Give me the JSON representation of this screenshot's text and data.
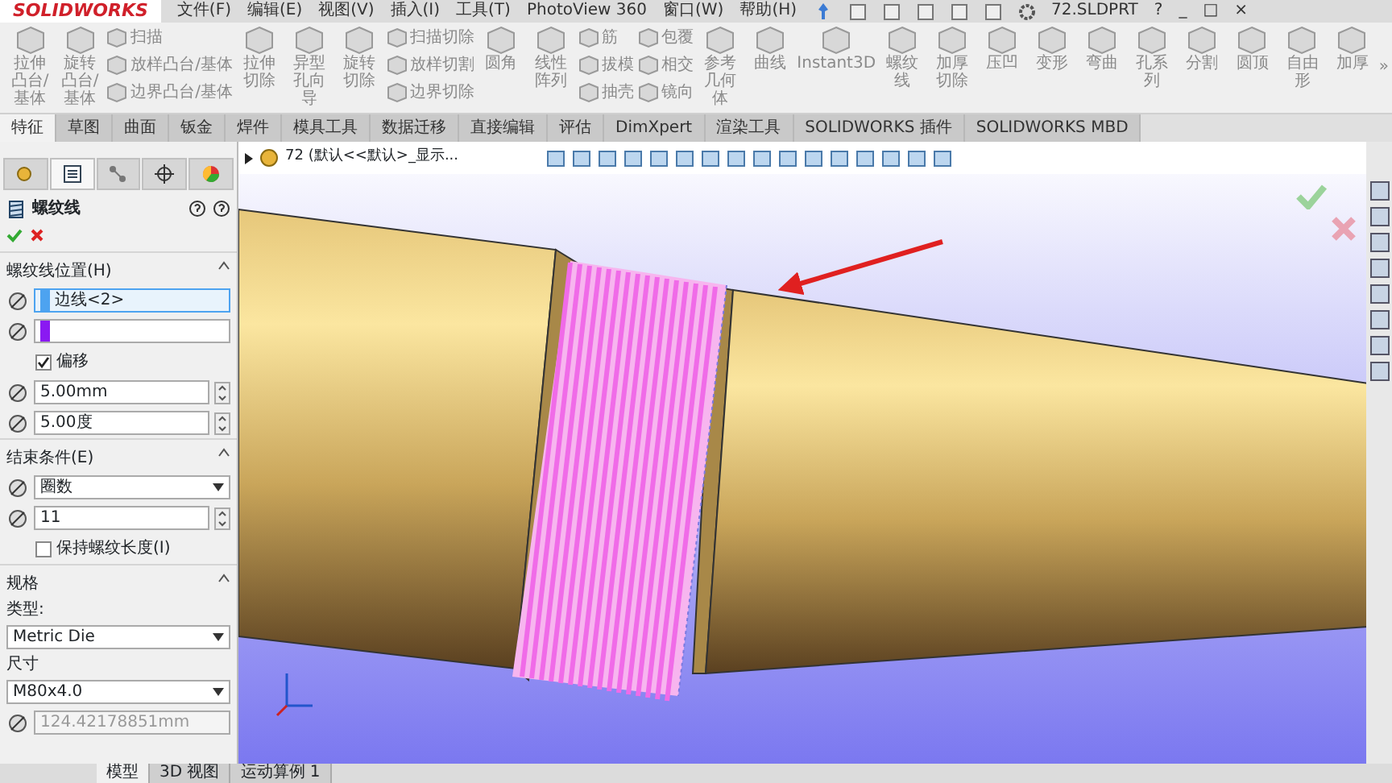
{
  "titlebar": {
    "logo": "SOLIDWORKS",
    "menu": [
      "文件(F)",
      "编辑(E)",
      "视图(V)",
      "插入(I)",
      "工具(T)",
      "PhotoView 360",
      "窗口(W)",
      "帮助(H)"
    ],
    "document": "72.SLDPRT",
    "controls": [
      "?",
      "_",
      "□",
      "×"
    ]
  },
  "ribbon": [
    {
      "kind": "large",
      "label": "拉伸凸台/基体"
    },
    {
      "kind": "large",
      "label": "旋转凸台/基体"
    },
    {
      "kind": "stack",
      "labels": [
        "扫描",
        "放样凸台/基体",
        "边界凸台/基体"
      ]
    },
    {
      "kind": "large",
      "label": "拉伸切除"
    },
    {
      "kind": "large",
      "label": "异型孔向导"
    },
    {
      "kind": "large",
      "label": "旋转切除"
    },
    {
      "kind": "stack",
      "labels": [
        "扫描切除",
        "放样切割",
        "边界切除"
      ]
    },
    {
      "kind": "large",
      "label": "圆角"
    },
    {
      "kind": "large",
      "label": "线性阵列"
    },
    {
      "kind": "stack",
      "labels": [
        "筋",
        "拔模",
        "抽壳"
      ]
    },
    {
      "kind": "stack",
      "labels": [
        "包覆",
        "相交",
        "镜向"
      ]
    },
    {
      "kind": "large",
      "label": "参考几何体"
    },
    {
      "kind": "large",
      "label": "曲线"
    },
    {
      "kind": "large",
      "label": "Instant3D"
    },
    {
      "kind": "large",
      "label": "螺纹线"
    },
    {
      "kind": "large",
      "label": "加厚切除"
    },
    {
      "kind": "large",
      "label": "压凹"
    },
    {
      "kind": "large",
      "label": "变形"
    },
    {
      "kind": "large",
      "label": "弯曲"
    },
    {
      "kind": "large",
      "label": "孔系列"
    },
    {
      "kind": "large",
      "label": "分割"
    },
    {
      "kind": "large",
      "label": "圆顶"
    },
    {
      "kind": "large",
      "label": "自由形"
    },
    {
      "kind": "large",
      "label": "加厚"
    },
    {
      "kind": "more",
      "label": "»"
    }
  ],
  "tabs": [
    {
      "label": "特征",
      "selected": true
    },
    {
      "label": "草图",
      "selected": false
    },
    {
      "label": "曲面",
      "selected": false
    },
    {
      "label": "钣金",
      "selected": false
    },
    {
      "label": "焊件",
      "selected": false
    },
    {
      "label": "模具工具",
      "selected": false
    },
    {
      "label": "数据迁移",
      "selected": false
    },
    {
      "label": "直接编辑",
      "selected": false
    },
    {
      "label": "评估",
      "selected": false
    },
    {
      "label": "DimXpert",
      "selected": false
    },
    {
      "label": "渲染工具",
      "selected": false
    },
    {
      "label": "SOLIDWORKS 插件",
      "selected": false
    },
    {
      "label": "SOLIDWORKS MBD",
      "selected": false
    }
  ],
  "panel_tabs": [
    {
      "selected": false
    },
    {
      "selected": true
    },
    {
      "selected": false
    },
    {
      "selected": false
    },
    {
      "selected": false
    }
  ],
  "property_manager": {
    "title": "螺纹线",
    "sections": [
      {
        "title": "螺纹线位置(H)",
        "rows": [
          {
            "kind": "selection",
            "value": "边线<2>",
            "color": "#4da3f0"
          },
          {
            "kind": "selection",
            "value": "",
            "color": "#8a19f2"
          },
          {
            "kind": "checkbox",
            "label": "偏移",
            "checked": true
          },
          {
            "kind": "spinner",
            "value": "5.00mm"
          },
          {
            "kind": "spinner",
            "value": "5.00度"
          }
        ]
      },
      {
        "title": "结束条件(E)",
        "rows": [
          {
            "kind": "select",
            "value": "圈数"
          },
          {
            "kind": "spinner",
            "value": "11"
          },
          {
            "kind": "checkbox",
            "label": "保持螺纹长度(I)",
            "checked": false
          }
        ]
      },
      {
        "title": "规格",
        "rows": [
          {
            "kind": "caption",
            "label": "类型:"
          },
          {
            "kind": "select",
            "value": "Metric Die"
          },
          {
            "kind": "caption",
            "label": "尺寸"
          },
          {
            "kind": "select",
            "value": "M80x4.0"
          },
          {
            "kind": "readonly",
            "value": "124.42178851mm",
            "disabled": true
          }
        ]
      }
    ]
  },
  "viewport": {
    "tree_item": "72  (默认<<默认>_显示..."
  },
  "bottom_tabs": [
    {
      "label": "模型",
      "selected": true
    },
    {
      "label": "3D 视图",
      "selected": false
    },
    {
      "label": "运动算例 1",
      "selected": false
    }
  ]
}
